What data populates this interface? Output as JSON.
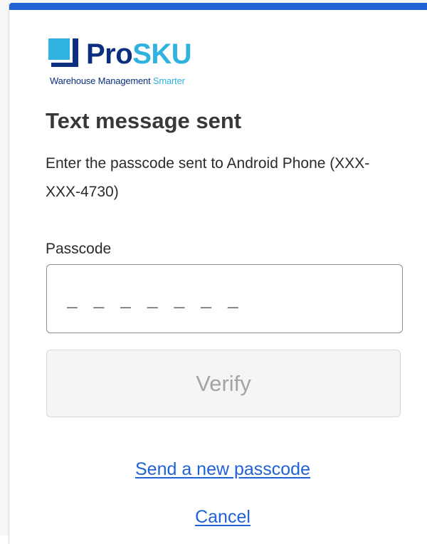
{
  "logo": {
    "wordmark_pro": "Pro",
    "wordmark_sku": "SKU",
    "tagline_main": "Warehouse Management",
    "tagline_accent": "Smarter"
  },
  "title": "Text message sent",
  "description": "Enter the passcode sent to Android Phone (XXX-XXX-4730)",
  "passcode": {
    "label": "Passcode",
    "placeholder": "_ _ _ _ _ _ _",
    "value": ""
  },
  "verify_label": "Verify",
  "links": {
    "send_new": "Send a new passcode",
    "cancel": "Cancel"
  },
  "colors": {
    "accent_bar": "#1f62d6",
    "link": "#1f62d6",
    "brand_dark": "#0b2e7e",
    "brand_light": "#2fb2e0"
  }
}
